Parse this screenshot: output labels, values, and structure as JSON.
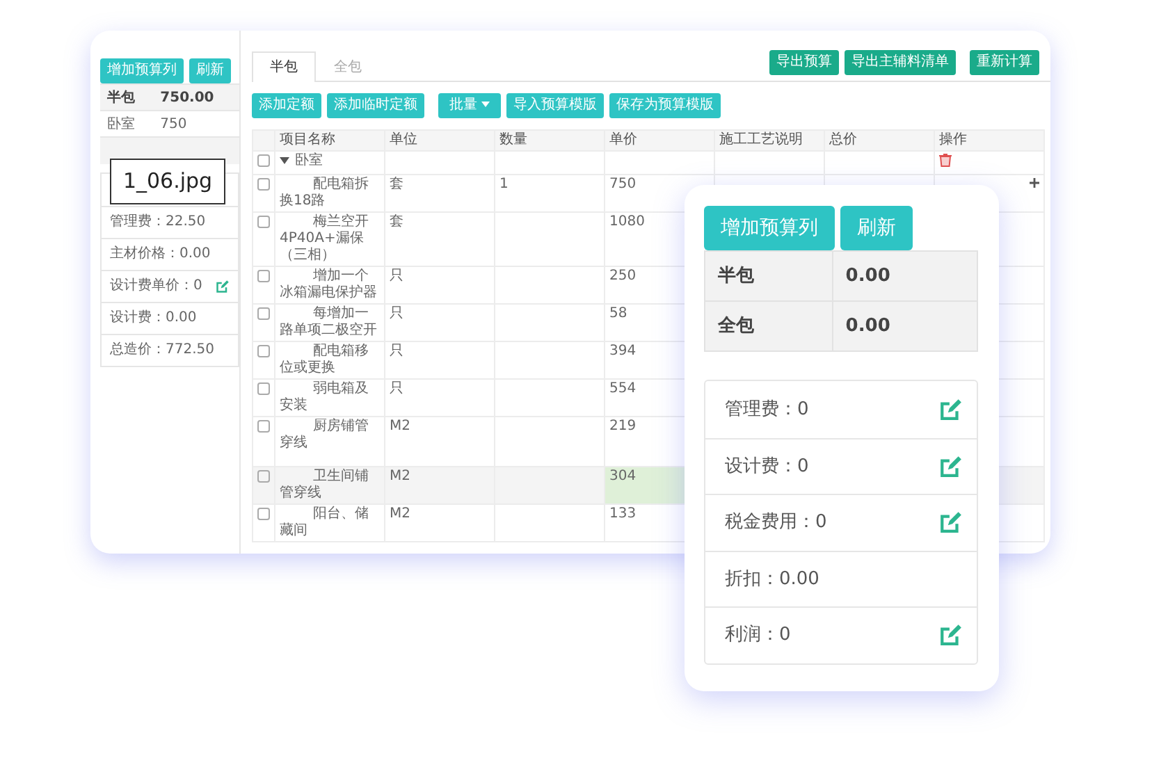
{
  "back_window": {
    "sidebar": {
      "buttons": [
        "增加预算列",
        "刷新"
      ],
      "summary": [
        {
          "label": "半包",
          "value": "750.00",
          "bold": true
        },
        {
          "label": "卧室",
          "value": "750",
          "bold": false
        }
      ],
      "fees": [
        {
          "text": "管理费：22.50",
          "editable": false
        },
        {
          "text": "主材价格：0.00",
          "editable": false
        },
        {
          "text": "设计费单价：0",
          "editable": true
        },
        {
          "text": "设计费：0.00",
          "editable": false
        },
        {
          "text": "总造价：772.50",
          "editable": false
        }
      ]
    },
    "tabs": [
      {
        "label": "半包",
        "selected": true
      },
      {
        "label": "全包",
        "selected": false
      }
    ],
    "export_buttons": [
      "导出预算",
      "导出主辅料清单",
      "重新计算"
    ],
    "toolbar_buttons": [
      {
        "label": "添加定额",
        "kind": "plain"
      },
      {
        "label": "添加临时定额",
        "kind": "plain"
      },
      {
        "label": "批量",
        "kind": "dropdown"
      },
      {
        "label": "导入预算模版",
        "kind": "plain"
      },
      {
        "label": "保存为预算模版",
        "kind": "plain"
      }
    ],
    "table": {
      "columns": [
        "项目名称",
        "单位",
        "数量",
        "单价",
        "施工工艺说明",
        "总价",
        "操作"
      ],
      "group": {
        "label": "卧室",
        "expanded": true,
        "checked": false
      },
      "rows": [
        {
          "name": "配电箱拆换18路",
          "unit": "套",
          "quantity": "1",
          "price": "750",
          "checked": false,
          "highlighted": false
        },
        {
          "name": "梅兰空开4P40A+漏保（三相）",
          "unit": "套",
          "quantity": "",
          "price": "1080",
          "checked": false,
          "highlighted": false
        },
        {
          "name": "增加一个冰箱漏电保护器",
          "unit": "只",
          "quantity": "",
          "price": "250",
          "checked": false,
          "highlighted": false
        },
        {
          "name": "每增加一路单项二极空开",
          "unit": "只",
          "quantity": "",
          "price": "58",
          "checked": false,
          "highlighted": false
        },
        {
          "name": "配电箱移位或更换",
          "unit": "只",
          "quantity": "",
          "price": "394",
          "checked": false,
          "highlighted": false
        },
        {
          "name": "弱电箱及安装",
          "unit": "只",
          "quantity": "",
          "price": "554",
          "checked": false,
          "highlighted": false
        },
        {
          "name": "厨房铺管穿线",
          "unit": "M2",
          "quantity": "",
          "price": "219",
          "checked": false,
          "highlighted": false
        },
        {
          "name": "卫生间铺管穿线",
          "unit": "M2",
          "quantity": "",
          "price": "304",
          "checked": false,
          "highlighted": true
        },
        {
          "name": "阳台、储藏间",
          "unit": "M2",
          "quantity": "",
          "price": "133",
          "checked": false,
          "highlighted": false
        }
      ]
    }
  },
  "floating_panel": {
    "buttons": [
      "增加预算列",
      "刷新"
    ],
    "summary": [
      {
        "label": "半包",
        "value": "0.00"
      },
      {
        "label": "全包",
        "value": "0.00"
      }
    ],
    "fees": [
      {
        "text": "管理费：0",
        "editable": true
      },
      {
        "text": "设计费：0",
        "editable": true
      },
      {
        "text": "税金费用：0",
        "editable": true
      },
      {
        "text": "折扣：0.00",
        "editable": false
      },
      {
        "text": "利润：0",
        "editable": true
      }
    ]
  },
  "file_label": "1_06.jpg"
}
